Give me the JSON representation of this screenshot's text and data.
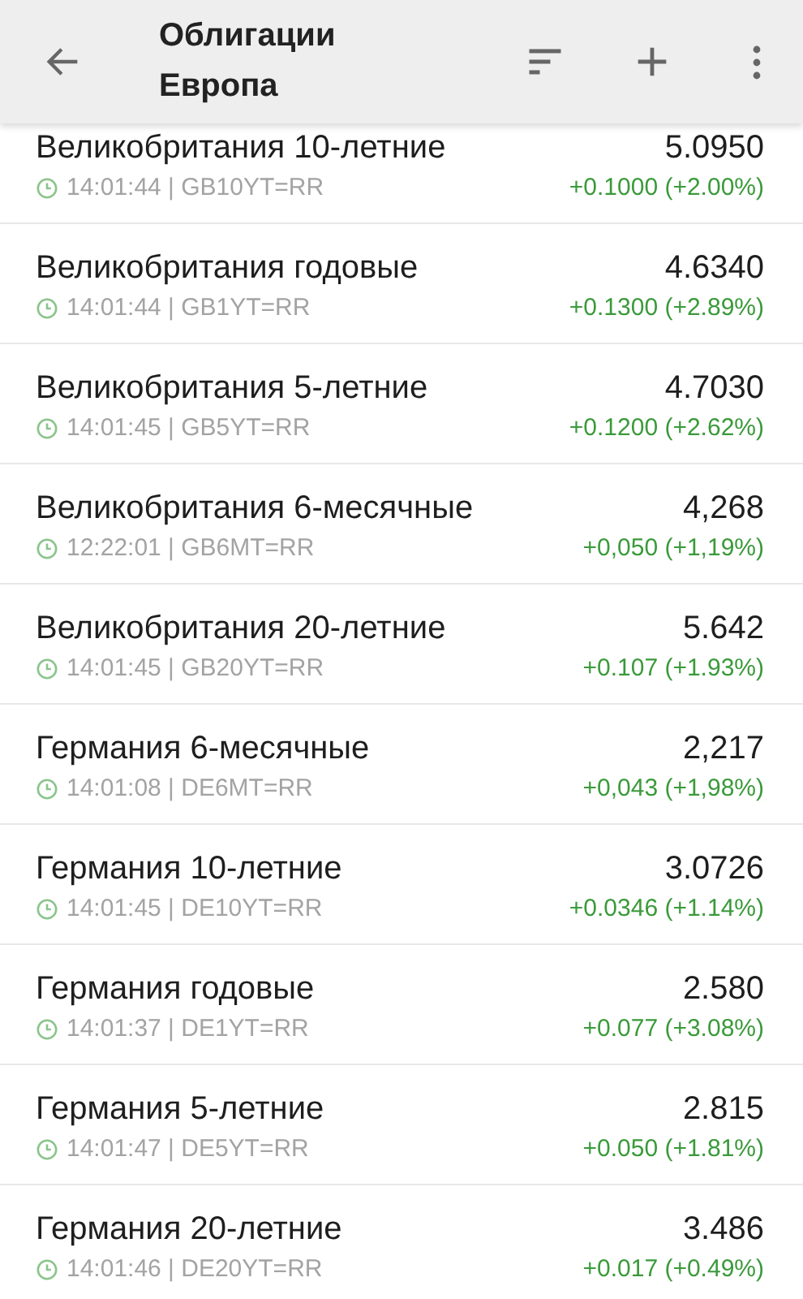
{
  "toolbar": {
    "title": "Облигации Европа"
  },
  "bonds": [
    {
      "name": "Великобритания 10-летние",
      "info": "14:01:44 | GB10YT=RR",
      "price": "5.0950",
      "change": "+0.1000 (+2.00%)"
    },
    {
      "name": "Великобритания годовые",
      "info": "14:01:44 | GB1YT=RR",
      "price": "4.6340",
      "change": "+0.1300 (+2.89%)"
    },
    {
      "name": "Великобритания 5-летние",
      "info": "14:01:45 | GB5YT=RR",
      "price": "4.7030",
      "change": "+0.1200 (+2.62%)"
    },
    {
      "name": "Великобритания 6-месячные",
      "info": "12:22:01 | GB6MT=RR",
      "price": "4,268",
      "change": "+0,050 (+1,19%)"
    },
    {
      "name": "Великобритания 20-летние",
      "info": "14:01:45 | GB20YT=RR",
      "price": "5.642",
      "change": "+0.107 (+1.93%)"
    },
    {
      "name": "Германия 6-месячные",
      "info": "14:01:08 | DE6MT=RR",
      "price": "2,217",
      "change": "+0,043 (+1,98%)"
    },
    {
      "name": "Германия 10-летние",
      "info": "14:01:45 | DE10YT=RR",
      "price": "3.0726",
      "change": "+0.0346 (+1.14%)"
    },
    {
      "name": "Германия годовые",
      "info": "14:01:37 | DE1YT=RR",
      "price": "2.580",
      "change": "+0.077 (+3.08%)"
    },
    {
      "name": "Германия 5-летние",
      "info": "14:01:47 | DE5YT=RR",
      "price": "2.815",
      "change": "+0.050 (+1.81%)"
    },
    {
      "name": "Германия 20-летние",
      "info": "14:01:46 | DE20YT=RR",
      "price": "3.486",
      "change": "+0.017 (+0.49%)"
    }
  ]
}
